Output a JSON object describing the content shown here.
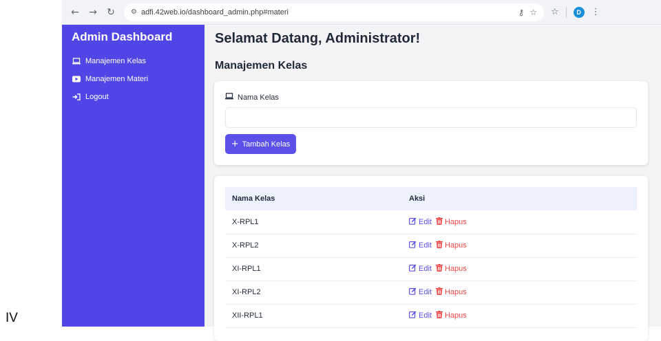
{
  "browser": {
    "url": "adfi.42web.io/dashboard_admin.php#materi",
    "profile_initial": "D"
  },
  "side_text": "IV",
  "sidebar": {
    "title": "Admin Dashboard",
    "items": [
      {
        "label": "Manajemen Kelas",
        "icon": "laptop-icon"
      },
      {
        "label": "Manajemen Materi",
        "icon": "video-icon"
      },
      {
        "label": "Logout",
        "icon": "logout-icon"
      }
    ]
  },
  "main": {
    "greeting": "Selamat Datang, Administrator!",
    "section_title": "Manajemen Kelas",
    "form": {
      "label": "Nama Kelas",
      "value": "",
      "placeholder": "",
      "add_button": "Tambah Kelas"
    },
    "table": {
      "headers": [
        "Nama Kelas",
        "Aksi"
      ],
      "rows": [
        {
          "name": "X-RPL1",
          "edit": "Edit",
          "delete": "Hapus"
        },
        {
          "name": "X-RPL2",
          "edit": "Edit",
          "delete": "Hapus"
        },
        {
          "name": "XI-RPL1",
          "edit": "Edit",
          "delete": "Hapus"
        },
        {
          "name": "XI-RPL2",
          "edit": "Edit",
          "delete": "Hapus"
        },
        {
          "name": "XII-RPL1",
          "edit": "Edit",
          "delete": "Hapus"
        }
      ]
    }
  },
  "colors": {
    "sidebar": "#5046e5",
    "primary": "#5b50ea",
    "danger": "#ef4444",
    "table_header": "#eef2ff"
  }
}
